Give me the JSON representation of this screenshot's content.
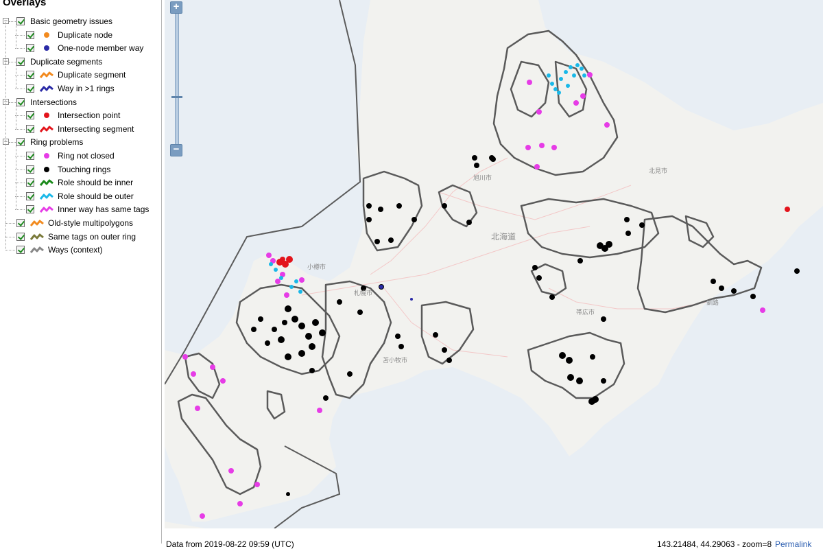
{
  "sidebar": {
    "title": "Overlays",
    "groups": [
      {
        "label": "Basic geometry issues",
        "items": [
          {
            "label": "Duplicate node",
            "color": "#f28a1e",
            "symbol": "dot"
          },
          {
            "label": "One-node member way",
            "color": "#2a2aa6",
            "symbol": "dot"
          }
        ]
      },
      {
        "label": "Duplicate segments",
        "items": [
          {
            "label": "Duplicate segment",
            "color": "#f28a1e",
            "symbol": "wave"
          },
          {
            "label": "Way in >1 rings",
            "color": "#2a2aa6",
            "symbol": "wave"
          }
        ]
      },
      {
        "label": "Intersections",
        "items": [
          {
            "label": "Intersection point",
            "color": "#e3141b",
            "symbol": "dot"
          },
          {
            "label": "Intersecting segment",
            "color": "#e3141b",
            "symbol": "wave"
          }
        ]
      },
      {
        "label": "Ring problems",
        "items": [
          {
            "label": "Ring not closed",
            "color": "#e63ce6",
            "symbol": "dot"
          },
          {
            "label": "Touching rings",
            "color": "#000000",
            "symbol": "dot"
          },
          {
            "label": "Role should be inner",
            "color": "#1a8a1a",
            "symbol": "wave"
          },
          {
            "label": "Role should be outer",
            "color": "#19b8e8",
            "symbol": "wave"
          },
          {
            "label": "Inner way has same tags",
            "color": "#e63ce6",
            "symbol": "wave"
          }
        ]
      }
    ],
    "standalone": [
      {
        "label": "Old-style multipolygons",
        "color": "#f28a1e",
        "symbol": "wave"
      },
      {
        "label": "Same tags on outer ring",
        "color": "#7a7a3a",
        "symbol": "wave"
      },
      {
        "label": "Ways (context)",
        "color": "#888888",
        "symbol": "wave"
      }
    ]
  },
  "map": {
    "labels": {
      "asahikawa": "旭川市",
      "kitami": "北見市",
      "hokkaido": "北海道",
      "otaru": "小樽市",
      "sapporo": "札幌市",
      "obihiro": "帯広市",
      "kushiro": "釧路",
      "tomakomai": "苫小牧市"
    },
    "colors": {
      "water": "#e8eef4",
      "land": "#f2f2ef",
      "boundary": "#5b5b5b",
      "ways": "#5a5a5a",
      "touching": "#000000",
      "not_closed": "#e63ce6",
      "role_outer": "#19b8e8",
      "intersection": "#e3141b"
    }
  },
  "status": {
    "date": "Data from 2019-08-22 09:59 (UTC)",
    "coords": "143.21484, 44.29063 - zoom=8",
    "link": "Permalink"
  }
}
